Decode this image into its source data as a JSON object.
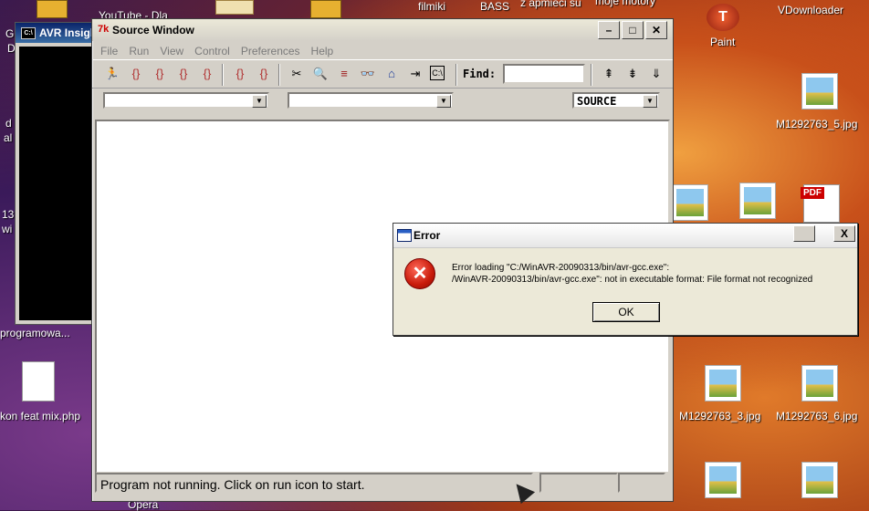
{
  "desktop": {
    "top_labels": [
      "YouTube - Dla",
      "filmiki",
      "BASS",
      "z apmieci su",
      "moje motory",
      "VDownloader"
    ],
    "paint_label": "Paint",
    "files": [
      "M1292763_5.jpg",
      "programowa...",
      "kon feat mix.php",
      "M1292763_3.jpg",
      "M1292763_6.jpg",
      "Opera"
    ],
    "left_edge": [
      "G",
      "D",
      "d",
      "al",
      "13",
      "wi"
    ]
  },
  "avr_window": {
    "title": "AVR Insigh"
  },
  "source_window": {
    "title": "Source Window",
    "menu": [
      "File",
      "Run",
      "View",
      "Control",
      "Preferences",
      "Help"
    ],
    "find_label": "Find:",
    "find_value": "",
    "select1_value": "",
    "select2_value": "",
    "source_select_value": "SOURCE",
    "status_text": "Program not running. Click on run icon to start."
  },
  "error_dialog": {
    "title": "Error",
    "message_line1": "Error loading \"C:/WinAVR-20090313/bin/avr-gcc.exe\":",
    "message_line2": "/WinAVR-20090313/bin/avr-gcc.exe\": not in executable format: File format not recognized",
    "ok_label": "OK",
    "close_label": "X"
  }
}
